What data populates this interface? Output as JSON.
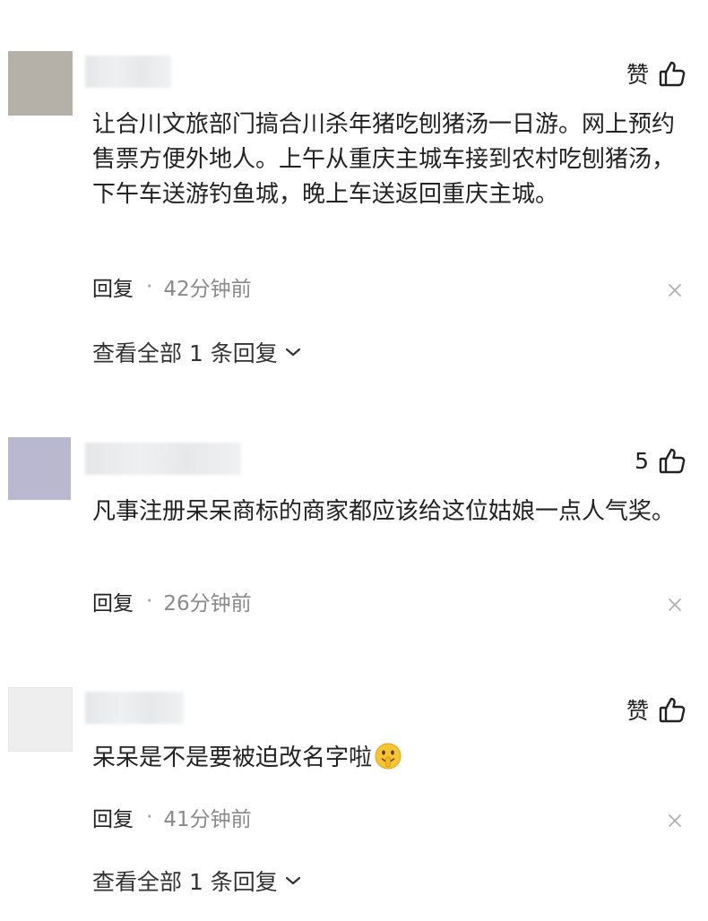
{
  "comments": [
    {
      "avatar_color": "#b5b0a8",
      "like_label": "赞",
      "text": "让合川文旅部门搞合川杀年猪吃刨猪汤一日游。网上预约售票方便外地人。上午从重庆主城车接到农村吃刨猪汤，下午车送游钓鱼城，晚上车送返回重庆主城。",
      "reply_label": "回复",
      "separator": "·",
      "time": "42分钟前",
      "view_all_label": "查看全部 1 条回复"
    },
    {
      "avatar_color": "#b9b8d0",
      "like_label": "5",
      "text": "凡事注册呆呆商标的商家都应该给这位姑娘一点人气奖。",
      "reply_label": "回复",
      "separator": "·",
      "time": "26分钟前"
    },
    {
      "avatar_color": "#eeeeee",
      "like_label": "赞",
      "text": "呆呆是不是要被迫改名字啦",
      "reply_label": "回复",
      "separator": "·",
      "time": "41分钟前",
      "view_all_label": "查看全部 1 条回复"
    }
  ],
  "icons": {
    "like": "thumbs-up-icon",
    "close": "close-icon",
    "expand": "chevron-down-icon",
    "emoji": "emoji-shush-icon"
  }
}
